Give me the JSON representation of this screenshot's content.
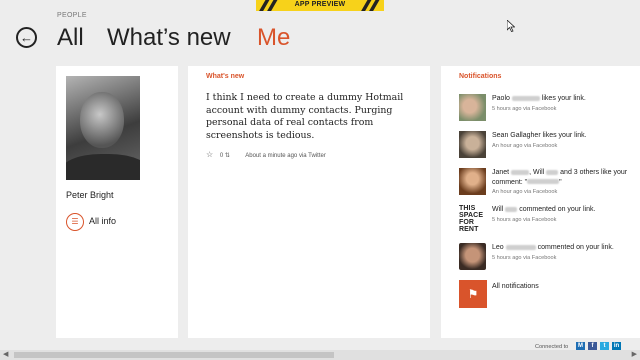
{
  "banner": "APP PREVIEW",
  "app_label": "PEOPLE",
  "nav": {
    "all": "All",
    "whats_new": "What’s new",
    "me": "Me"
  },
  "profile": {
    "name": "Peter Bright",
    "all_info": "All info"
  },
  "whats_new": {
    "title": "What's new",
    "post": "I think I need to create a dummy Hotmail account with dummy contacts. Purging personal data of real contacts from screenshots is tedious.",
    "count": "0",
    "meta": "About a minute ago via Twitter"
  },
  "notifications": {
    "title": "Notifications",
    "items": [
      {
        "name": "Paolo",
        "action": "likes your link.",
        "meta": "5 hours ago via Facebook"
      },
      {
        "name": "Sean Gallagher",
        "action": "likes your link.",
        "meta": "An hour ago via Facebook"
      },
      {
        "name": "Janet",
        "mid": ", Will",
        "action": "and 3 others like your comment: \"",
        "action2": "\"",
        "meta": "An hour ago via Facebook"
      },
      {
        "avatar_text": "THIS SPACE FOR RENT",
        "name": "Will",
        "action": "commented on your link.",
        "meta": "5 hours ago via Facebook"
      },
      {
        "name": "Leo",
        "action": "commented on your link.",
        "meta": "5 hours ago via Facebook"
      }
    ],
    "all_label": "All notifications"
  },
  "footer": {
    "connected_to": "Connected to"
  },
  "colors": {
    "accent": "#d9542b",
    "banner": "#f7d21a"
  }
}
